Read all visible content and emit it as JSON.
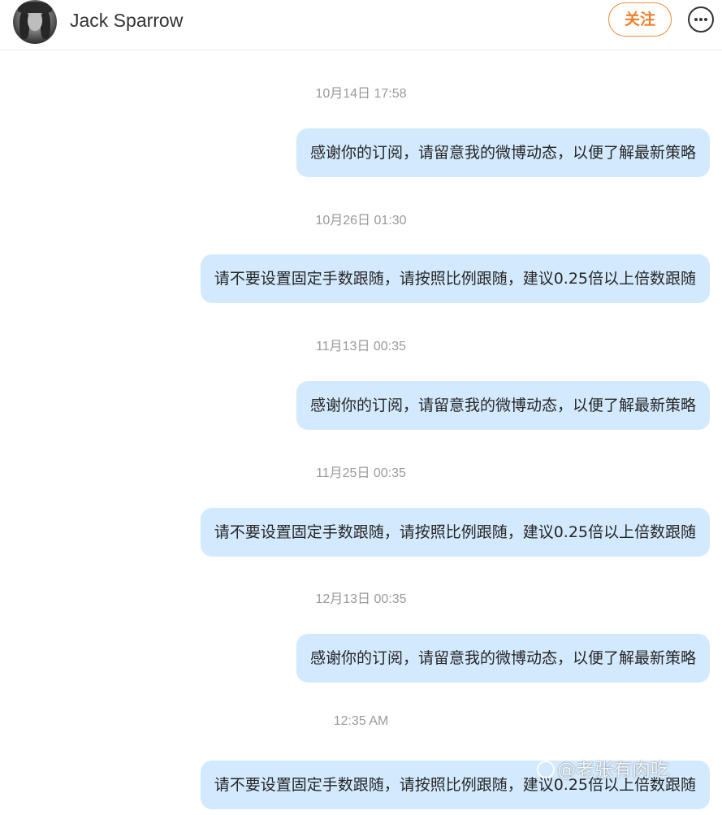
{
  "header": {
    "username": "Jack Sparrow",
    "follow_label": "关注",
    "avatar_icon": "user-avatar-icon",
    "more_icon": "more-options-icon"
  },
  "colors": {
    "bubble": "#d3e9fd",
    "accent": "#f07f2c",
    "timestamp": "#9a9a9a"
  },
  "messages": [
    {
      "time": "10月14日 17:58",
      "text": "感谢你的订阅，请留意我的微博动态，以便了解最新策略"
    },
    {
      "time": "10月26日 01:30",
      "text": "请不要设置固定手数跟随，请按照比例跟随，建议0.25倍以上倍数跟随"
    },
    {
      "time": "11月13日 00:35",
      "text": "感谢你的订阅，请留意我的微博动态，以便了解最新策略"
    },
    {
      "time": "11月25日 00:35",
      "text": "请不要设置固定手数跟随，请按照比例跟随，建议0.25倍以上倍数跟随"
    },
    {
      "time": "12月13日 00:35",
      "text": "感谢你的订阅，请留意我的微博动态，以便了解最新策略"
    },
    {
      "time": "12:35 AM",
      "text": "请不要设置固定手数跟随，请按照比例跟随，建议0.25倍以上倍数跟随"
    }
  ],
  "watermark": {
    "text": "@老张有肉吃"
  }
}
